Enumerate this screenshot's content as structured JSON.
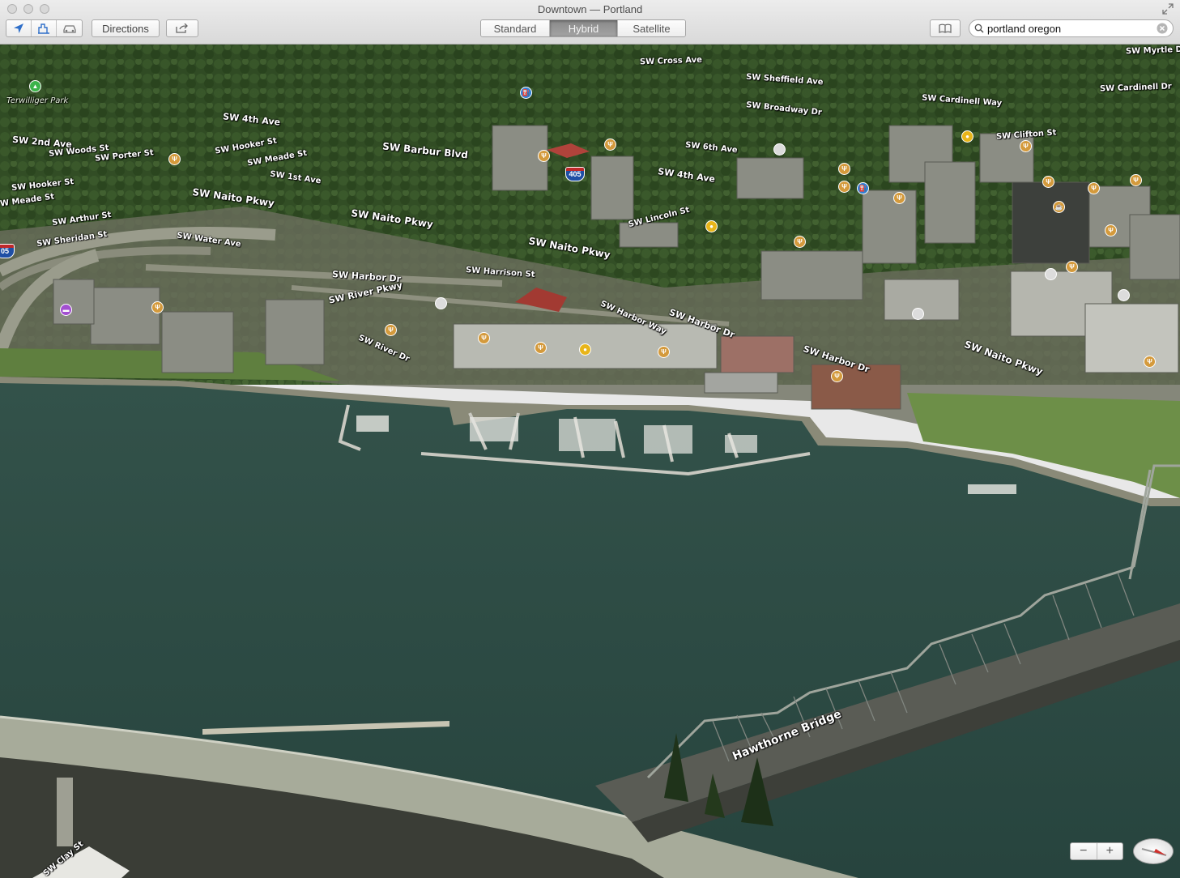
{
  "window": {
    "title": "Downtown — Portland"
  },
  "toolbar": {
    "directions_label": "Directions",
    "map_types": [
      "Standard",
      "Hybrid",
      "Satellite"
    ],
    "active_map_type": "Hybrid",
    "search_value": "portland oregon"
  },
  "map": {
    "street_labels": [
      "Terwilliger Park",
      "SW 4th Ave",
      "SW 2nd Ave",
      "SW Woods St",
      "SW Porter St",
      "SW Hooker St",
      "SW Meade St",
      "SW 1st Ave",
      "SW Barbur Blvd",
      "SW Hooker St",
      "W Meade St",
      "SW Naito Pkwy",
      "SW Arthur St",
      "SW Naito Pkwy",
      "SW Sheridan St",
      "SW Water Ave",
      "SW Naito Pkwy",
      "SW Harbor Dr",
      "SW River Pkwy",
      "SW Harrison St",
      "SW River Dr",
      "SW Harbor Way",
      "SW Harbor Dr",
      "SW Harbor Dr",
      "SW Naito Pkwy",
      "SW Cross Ave",
      "SW Sheffield Ave",
      "SW Broadway Dr",
      "SW Cardinell Way",
      "SW Myrtle Dr",
      "SW Cardinell Dr",
      "SW Clifton St",
      "SW 6th Ave",
      "SW 4th Ave",
      "SW Lincoln St",
      "Hawthorne Bridge",
      "SW Clay St"
    ],
    "highway_shields": [
      "405",
      "05"
    ],
    "zoom_out_label": "−",
    "zoom_in_label": "+"
  },
  "colors": {
    "water": "#2c4a44",
    "forest": "#2f4a24",
    "lawn": "#6d8f48",
    "pavement": "#a7ab9a"
  }
}
